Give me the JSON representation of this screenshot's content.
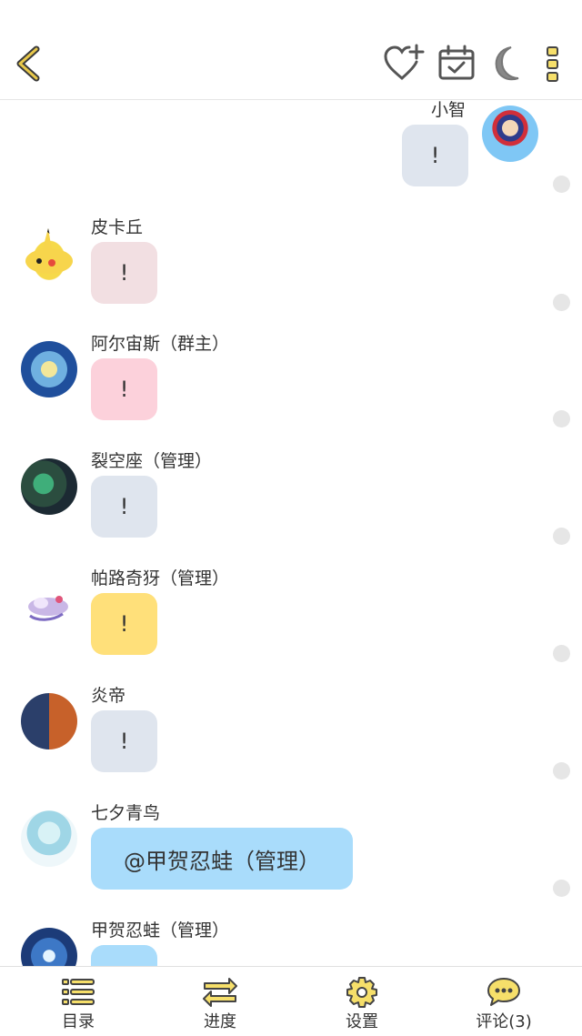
{
  "header": {
    "back_icon": "chevron-left-icon",
    "favorite_icon": "heart-plus-icon",
    "checkin_icon": "calendar-check-icon",
    "night_mode_icon": "moon-icon",
    "more_icon": "more-vertical-icon",
    "accent": "#d4b24a"
  },
  "messages": [
    {
      "sender": "小智",
      "text": "!",
      "side": "right",
      "bubble_color": "#dfe5ee"
    },
    {
      "sender": "皮卡丘",
      "text": "!",
      "side": "left",
      "bubble_color": "#f2dfe2"
    },
    {
      "sender": "阿尔宙斯（群主）",
      "text": "!",
      "side": "left",
      "bubble_color": "#fcd1db"
    },
    {
      "sender": "裂空座（管理）",
      "text": "!",
      "side": "left",
      "bubble_color": "#dfe5ee"
    },
    {
      "sender": "帕路奇犽（管理）",
      "text": "!",
      "side": "left",
      "bubble_color": "#ffe07a"
    },
    {
      "sender": "炎帝",
      "text": "!",
      "side": "left",
      "bubble_color": "#dfe5ee"
    },
    {
      "sender": "七夕青鸟",
      "text": "@甲贺忍蛙（管理）",
      "side": "left",
      "bubble_color": "#a9dcfb"
    },
    {
      "sender": "甲贺忍蛙（管理）",
      "text": "",
      "side": "left",
      "bubble_color": "#a9dcfb"
    }
  ],
  "tabs": [
    {
      "label": "目录",
      "icon": "list-icon"
    },
    {
      "label": "进度",
      "icon": "swap-arrows-icon"
    },
    {
      "label": "设置",
      "icon": "gear-icon"
    },
    {
      "label": "评论(3)",
      "icon": "comment-bubble-icon"
    }
  ]
}
